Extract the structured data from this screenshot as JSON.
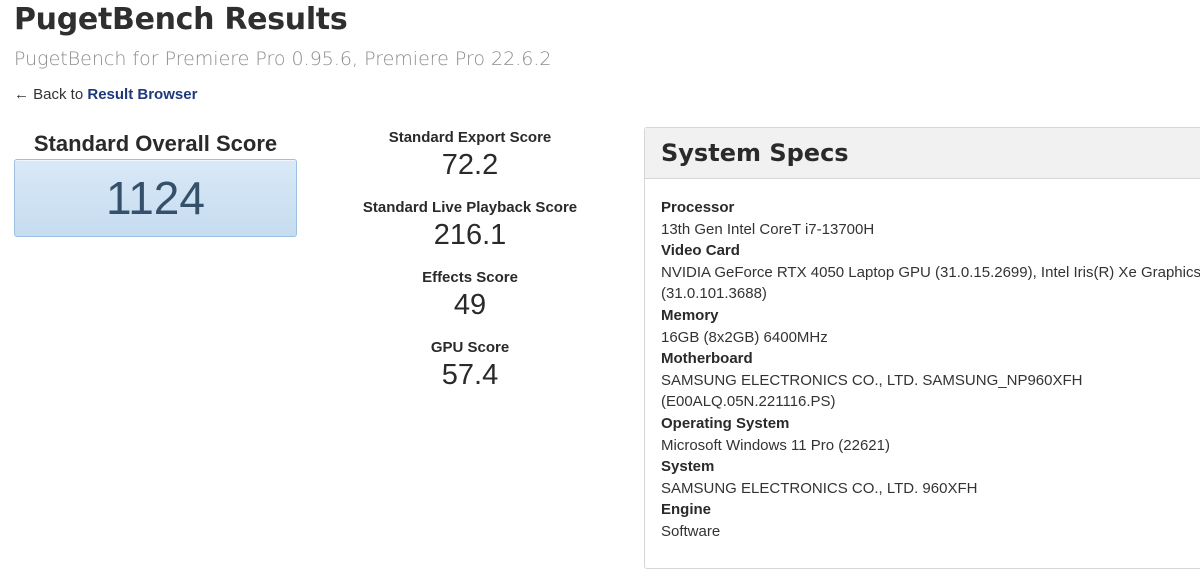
{
  "page": {
    "title": "PugetBench Results",
    "subtitle": "PugetBench for Premiere Pro 0.95.6, Premiere Pro 22.6.2",
    "back_arrow": "←",
    "back_prefix": "Back to",
    "back_link": "Result Browser"
  },
  "overall": {
    "label": "Standard Overall Score",
    "value": "1124"
  },
  "scores": [
    {
      "label": "Standard Export Score",
      "value": "72.2"
    },
    {
      "label": "Standard Live Playback Score",
      "value": "216.1"
    },
    {
      "label": "Effects Score",
      "value": "49"
    },
    {
      "label": "GPU Score",
      "value": "57.4"
    }
  ],
  "specs": {
    "title": "System Specs",
    "items": [
      {
        "label": "Processor",
        "value": "13th Gen Intel CoreT i7-13700H"
      },
      {
        "label": "Video Card",
        "value": "NVIDIA GeForce RTX 4050 Laptop GPU (31.0.15.2699), Intel Iris(R) Xe Graphics (31.0.101.3688)"
      },
      {
        "label": "Memory",
        "value": "16GB (8x2GB) 6400MHz"
      },
      {
        "label": "Motherboard",
        "value": "SAMSUNG ELECTRONICS CO., LTD. SAMSUNG_NP960XFH (E00ALQ.05N.221116.PS)"
      },
      {
        "label": "Operating System",
        "value": "Microsoft Windows 11 Pro (22621)"
      },
      {
        "label": "System",
        "value": "SAMSUNG ELECTRONICS CO., LTD. 960XFH"
      },
      {
        "label": "Engine",
        "value": "Software"
      }
    ]
  },
  "colors": {
    "link": "#1f3a7a",
    "score_box": "#c6dcf0",
    "score_text": "#35506a"
  }
}
